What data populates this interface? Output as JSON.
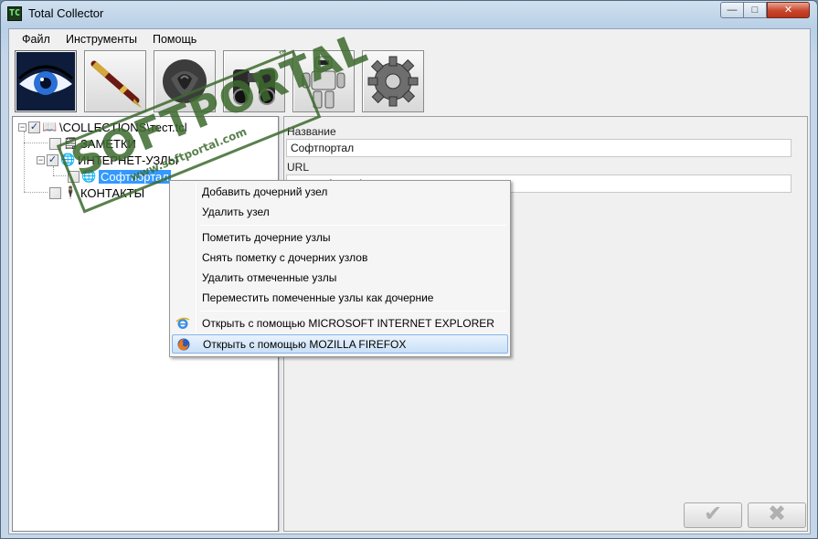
{
  "window": {
    "title": "Total Collector",
    "app_icon_text": "TC",
    "min": "—",
    "max": "□",
    "close": "✕"
  },
  "menu": {
    "items": [
      "Файл",
      "Инструменты",
      "Помощь"
    ]
  },
  "toolbar": {
    "buttons": [
      {
        "name": "eye"
      },
      {
        "name": "pen"
      },
      {
        "name": "rose"
      },
      {
        "name": "binoculars"
      },
      {
        "name": "robot"
      },
      {
        "name": "gear"
      }
    ]
  },
  "tree": {
    "root": {
      "label": "\\COLLECTIONS\\тест.tcl",
      "checked": true,
      "expanded": true,
      "icon": "collection-icon"
    },
    "nodes": [
      {
        "label": "ЗАМЕТКИ",
        "checked": false,
        "icon": "notes-icon"
      },
      {
        "label": "ИНТЕРНЕТ-УЗЛЫ",
        "checked": true,
        "icon": "globe-icon",
        "expanded": true
      },
      {
        "label": "Софтпортал",
        "checked": false,
        "icon": "globe-icon",
        "selected": true
      },
      {
        "label": "КОНТАКТЫ",
        "checked": false,
        "icon": "contact-icon"
      }
    ]
  },
  "details": {
    "name_label": "Название",
    "name_value": "Софтпортал",
    "url_label": "URL",
    "url_value": "www.softportal.com"
  },
  "context_menu": {
    "items": [
      "Добавить дочерний узел",
      "Удалить узел",
      "Пометить дочерние узлы",
      "Снять пометку с дочерних узлов",
      "Удалить отмеченные узлы",
      "Переместить помеченные узлы как дочерние",
      "Открыть с помощью MICROSOFT INTERNET EXPLORER",
      "Открыть с помощью MOZILLA FIREFOX"
    ],
    "hovered_index": 7
  },
  "buttons": {
    "ok": "✔",
    "cancel": "✖"
  },
  "watermark": {
    "text": "SOFTPORTAL",
    "tm": "™",
    "url": "www.softportal.com"
  }
}
